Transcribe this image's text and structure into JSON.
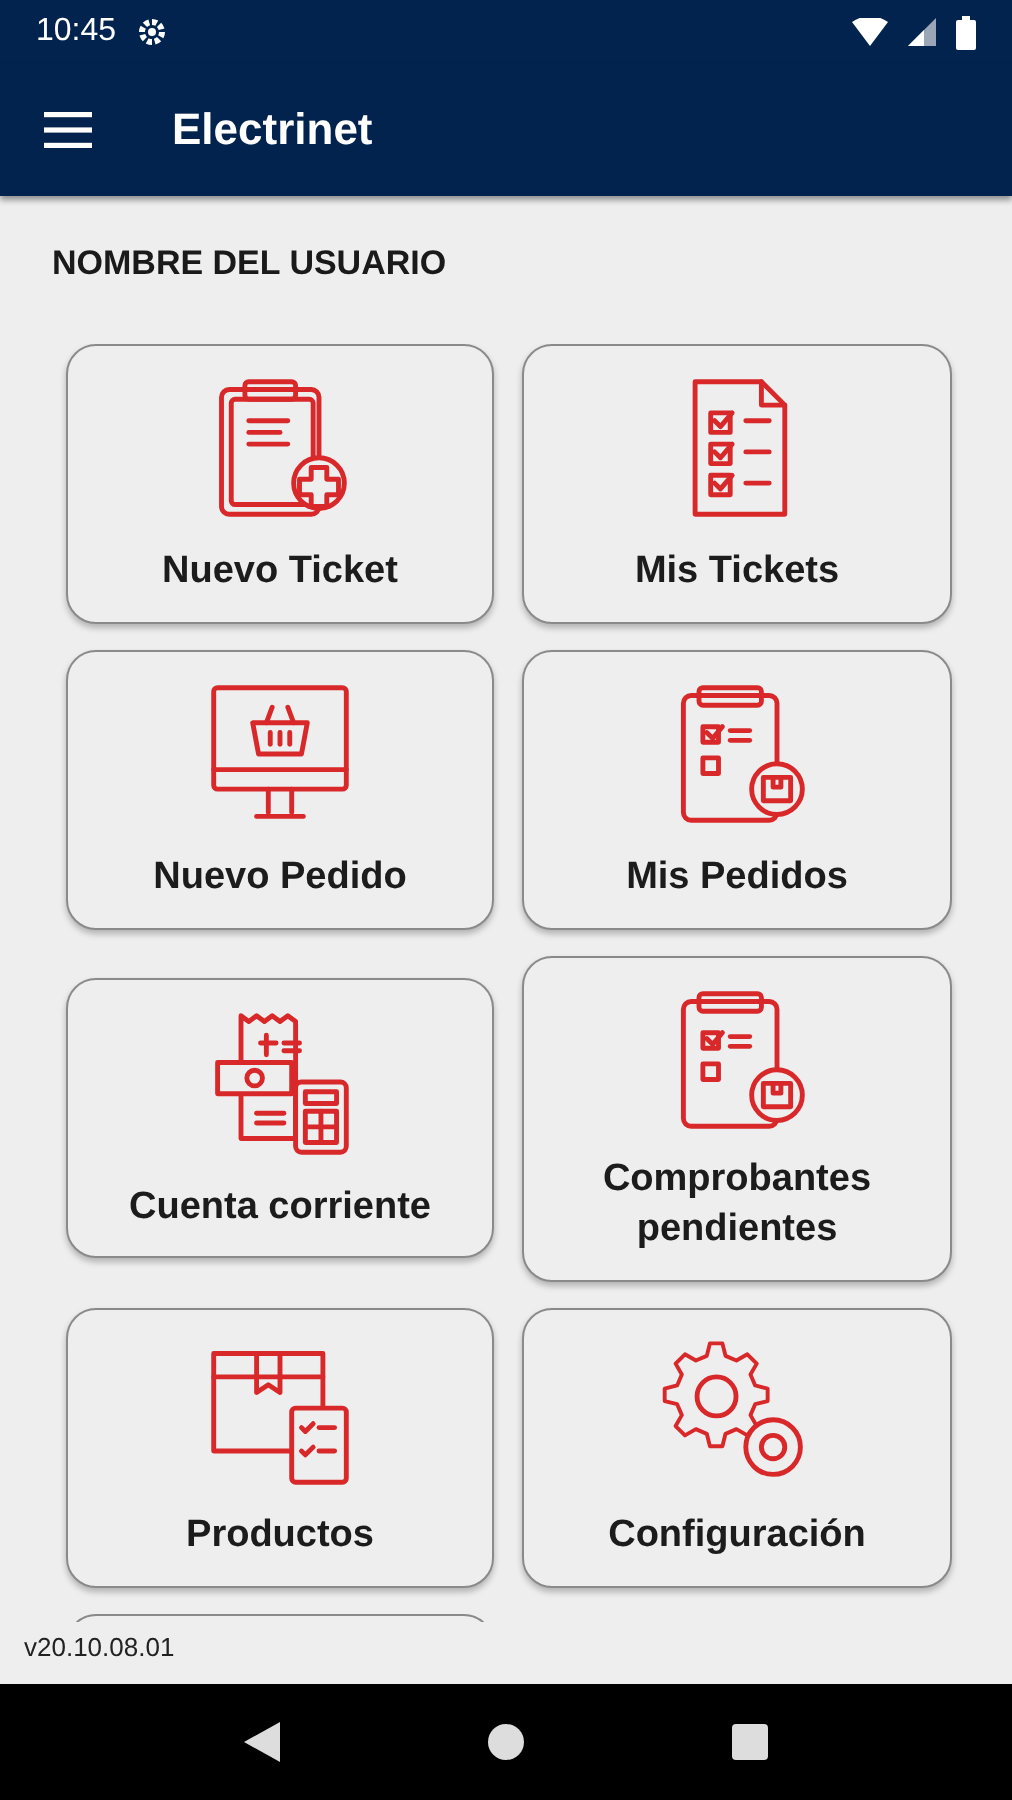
{
  "status_bar": {
    "time": "10:45"
  },
  "app_bar": {
    "title": "Electrinet"
  },
  "user_heading": "NOMBRE DEL USUARIO",
  "tile_rows": [
    {
      "tiles": [
        {
          "label": "Nuevo Ticket"
        },
        {
          "label": "Mis Tickets"
        }
      ]
    },
    {
      "tiles": [
        {
          "label": "Nuevo Pedido"
        },
        {
          "label": "Mis Pedidos"
        }
      ]
    },
    {
      "tiles": [
        {
          "label": "Cuenta corriente"
        },
        {
          "label": "Comprobantes pendientes"
        }
      ]
    },
    {
      "tiles": [
        {
          "label": "Productos"
        },
        {
          "label": "Configuración"
        }
      ]
    }
  ],
  "version": "v20.10.08.01"
}
